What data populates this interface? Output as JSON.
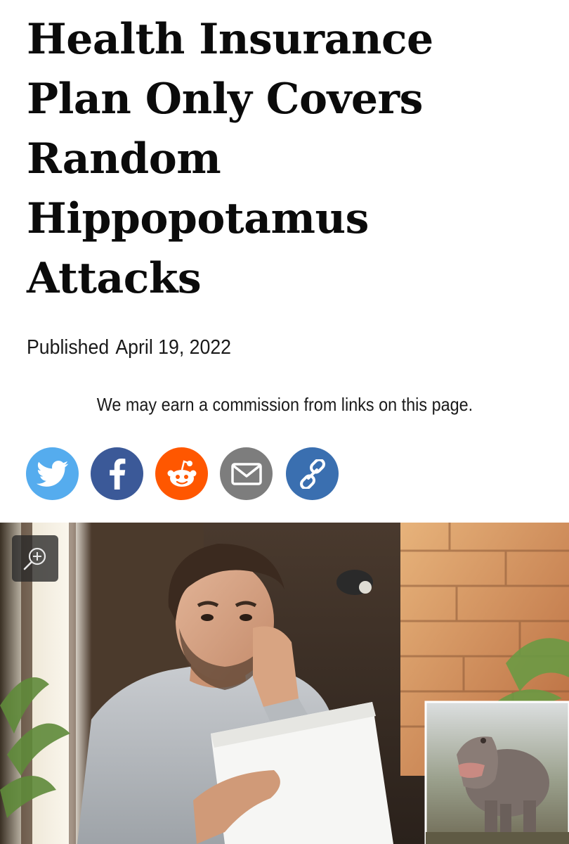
{
  "article": {
    "headline": "Health Insurance Plan Only Covers Random Hippopotamus Attacks",
    "published_label": "Published",
    "published_date": "April 19, 2022",
    "disclaimer": "We may earn a commission from links on this page."
  },
  "share": {
    "buttons": [
      {
        "network": "twitter",
        "icon": "twitter-bird-icon",
        "color": "#55acee"
      },
      {
        "network": "facebook",
        "icon": "facebook-f-icon",
        "color": "#3b5998"
      },
      {
        "network": "reddit",
        "icon": "reddit-alien-icon",
        "color": "#ff5700"
      },
      {
        "network": "email",
        "icon": "envelope-icon",
        "color": "#7d7d7d"
      },
      {
        "network": "copy-link",
        "icon": "chain-link-icon",
        "color": "#3a6fb0"
      }
    ]
  },
  "hero_image": {
    "zoom_icon": "zoom-in-magnifier-icon"
  }
}
